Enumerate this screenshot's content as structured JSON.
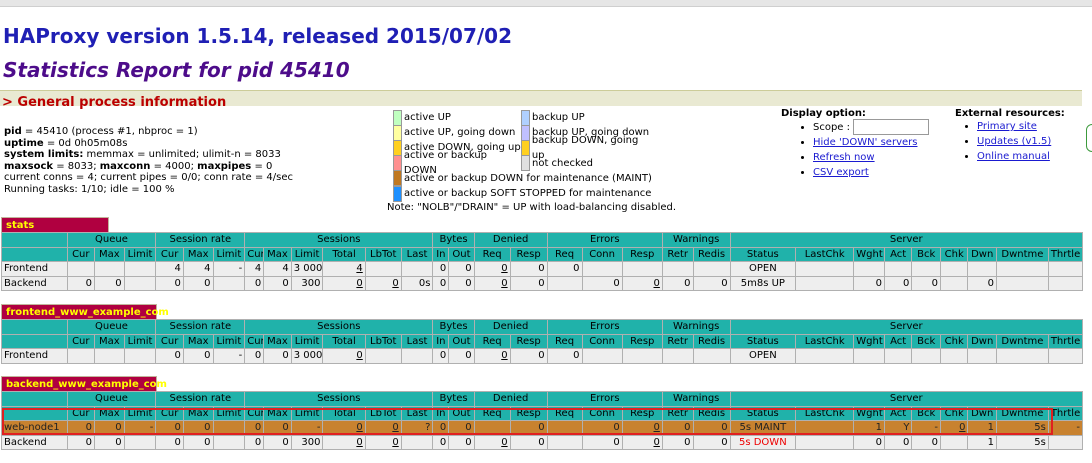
{
  "title": "HAProxy version 1.5.14, released 2015/07/02",
  "subtitle": "Statistics Report for pid 45410",
  "section_title": "> General process information",
  "process_info": [
    {
      "label": "pid",
      "value": " = 45410 (process #1, nbproc = 1)"
    },
    {
      "label": "uptime",
      "value": " = 0d 0h05m08s"
    },
    {
      "label": "system limits:",
      "value": " memmax = unlimited; ulimit-n = 8033"
    },
    {
      "label": "maxsock",
      "value": " = 8033; "
    },
    {
      "label": "current conns",
      "value": "current conns = 4; current pipes = 0/0; conn rate = 4/sec"
    },
    {
      "label": "running",
      "value": "Running tasks: 1/10; idle = 100 %"
    }
  ],
  "maxsock_line": {
    "maxconn_label": "maxconn",
    "maxconn_value": " = 4000; ",
    "maxpipes_label": "maxpipes",
    "maxpipes_value": " = 0"
  },
  "legend": {
    "rows": [
      [
        "active UP",
        "backup UP"
      ],
      [
        "active UP, going down",
        "backup UP, going down"
      ],
      [
        "active DOWN, going up",
        "backup DOWN, going up"
      ],
      [
        "active or backup DOWN",
        "not checked"
      ],
      [
        "active or backup DOWN for maintenance (MAINT)",
        ""
      ],
      [
        "active or backup SOFT STOPPED for maintenance",
        ""
      ]
    ],
    "colors": [
      [
        "#c0ffc0",
        "#b0d0ff"
      ],
      [
        "#ffffa0",
        "#c0c0ff"
      ],
      [
        "#ffd020",
        "#ffd020"
      ],
      [
        "#ff9090",
        "#e0e0e0"
      ],
      [
        "#c07820",
        ""
      ],
      [
        "#1e90ff",
        ""
      ]
    ],
    "note": "Note: \"NOLB\"/\"DRAIN\" = UP with load-balancing disabled."
  },
  "display_options": {
    "title": "Display option:",
    "scope_label": "Scope :",
    "scope_value": "",
    "links": [
      "Hide 'DOWN' servers",
      "Refresh now",
      "CSV export"
    ]
  },
  "external_resources": {
    "title": "External resources:",
    "links": [
      "Primary site",
      "Updates (v1.5)",
      "Online manual"
    ]
  },
  "header_groups": [
    "Queue",
    "Session rate",
    "Sessions",
    "Bytes",
    "Denied",
    "Errors",
    "Warnings",
    "Server"
  ],
  "header_cols": [
    "Cur",
    "Max",
    "Limit",
    "Cur",
    "Max",
    "Limit",
    "Cur",
    "Max",
    "Limit",
    "Total",
    "LbTot",
    "Last",
    "In",
    "Out",
    "Req",
    "Resp",
    "Req",
    "Conn",
    "Resp",
    "Retr",
    "Redis",
    "Status",
    "LastChk",
    "Wght",
    "Act",
    "Bck",
    "Chk",
    "Dwn",
    "Dwntme",
    "Thrtle"
  ],
  "proxies": [
    {
      "name": "stats",
      "rows": [
        {
          "name": "Frontend",
          "cells": [
            "",
            "",
            "",
            "4",
            "4",
            "-",
            "4",
            "4",
            "3 000",
            "4",
            "",
            "",
            "0",
            "0",
            "0",
            "0",
            "0",
            "",
            "",
            "",
            "",
            "OPEN",
            "",
            "",
            "",
            "",
            "",
            "",
            "",
            ""
          ]
        },
        {
          "name": "Backend",
          "cells": [
            "0",
            "0",
            "",
            "0",
            "0",
            "",
            "0",
            "0",
            "300",
            "0",
            "0",
            "0s",
            "0",
            "0",
            "0",
            "0",
            "",
            "0",
            "0",
            "0",
            "0",
            "5m8s UP",
            "",
            "0",
            "0",
            "0",
            "",
            "0",
            "",
            ""
          ]
        }
      ]
    },
    {
      "name": "frontend_www_example_com",
      "rows": [
        {
          "name": "Frontend",
          "cells": [
            "",
            "",
            "",
            "0",
            "0",
            "-",
            "0",
            "0",
            "3 000",
            "0",
            "",
            "",
            "0",
            "0",
            "0",
            "0",
            "0",
            "",
            "",
            "",
            "",
            "OPEN",
            "",
            "",
            "",
            "",
            "",
            "",
            "",
            ""
          ]
        }
      ]
    },
    {
      "name": "backend_www_example_com",
      "rows": [
        {
          "name": "web-node1",
          "cells": [
            "0",
            "0",
            "-",
            "0",
            "0",
            "",
            "0",
            "0",
            "-",
            "0",
            "0",
            "?",
            "0",
            "0",
            "",
            "0",
            "",
            "0",
            "0",
            "0",
            "0",
            "5s MAINT",
            "",
            "1",
            "Y",
            "-",
            "0",
            "1",
            "5s",
            "-"
          ]
        },
        {
          "name": "Backend",
          "cells": [
            "0",
            "0",
            "",
            "0",
            "0",
            "",
            "0",
            "0",
            "300",
            "0",
            "0",
            "",
            "0",
            "0",
            "0",
            "0",
            "",
            "0",
            "0",
            "0",
            "0",
            "5s DOWN",
            "",
            "0",
            "0",
            "0",
            "",
            "1",
            "5s",
            ""
          ]
        }
      ]
    }
  ]
}
